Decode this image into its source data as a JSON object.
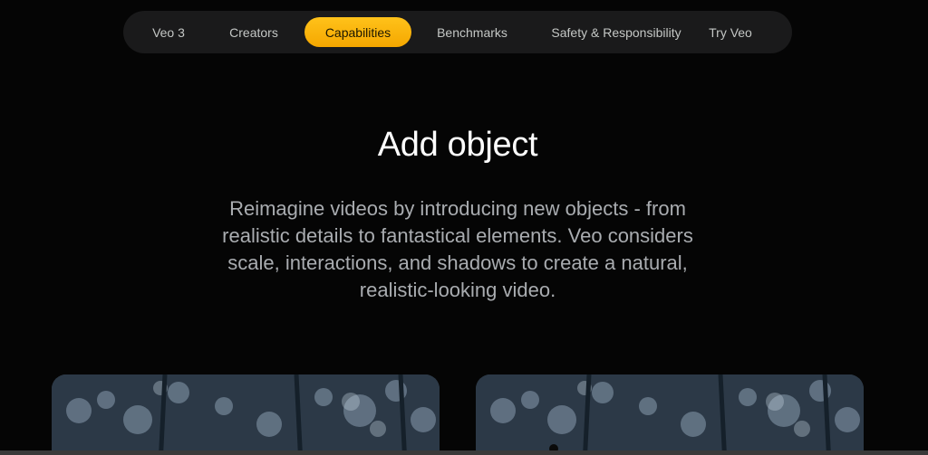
{
  "nav": {
    "items": [
      {
        "label": "Veo 3"
      },
      {
        "label": "Creators"
      },
      {
        "label": "Capabilities",
        "active": true
      },
      {
        "label": "Benchmarks"
      },
      {
        "label": "Safety & Responsibility"
      },
      {
        "label": "Try Veo"
      }
    ],
    "active_color": "#FBBC04"
  },
  "section": {
    "title": "Add object",
    "description": "Reimagine videos by introducing new objects - from realistic details to fantastical elements. Veo considers scale, interactions, and shadows to create a natural, realistic-looking video."
  },
  "videos": [
    {
      "icon": "forest-video-thumbnail"
    },
    {
      "icon": "forest-video-thumbnail"
    }
  ]
}
